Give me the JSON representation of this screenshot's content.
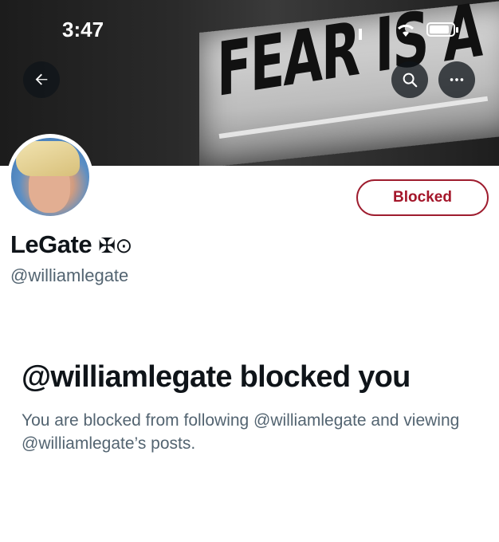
{
  "status_bar": {
    "time": "3:47"
  },
  "banner": {
    "text": "FEAR IS A LIE."
  },
  "navigation": {
    "back_icon": "arrow-left-icon",
    "search_icon": "search-icon",
    "more_icon": "more-horizontal-icon"
  },
  "profile": {
    "display_name": "LeGate",
    "name_emoji": "✠⊙",
    "handle": "@williamlegate",
    "relationship_button": "Blocked",
    "accent_color": "#a4162a"
  },
  "blocked_notice": {
    "title": "@williamlegate blocked you",
    "description": "You are blocked from following @williamlegate and viewing @williamlegate’s posts."
  }
}
